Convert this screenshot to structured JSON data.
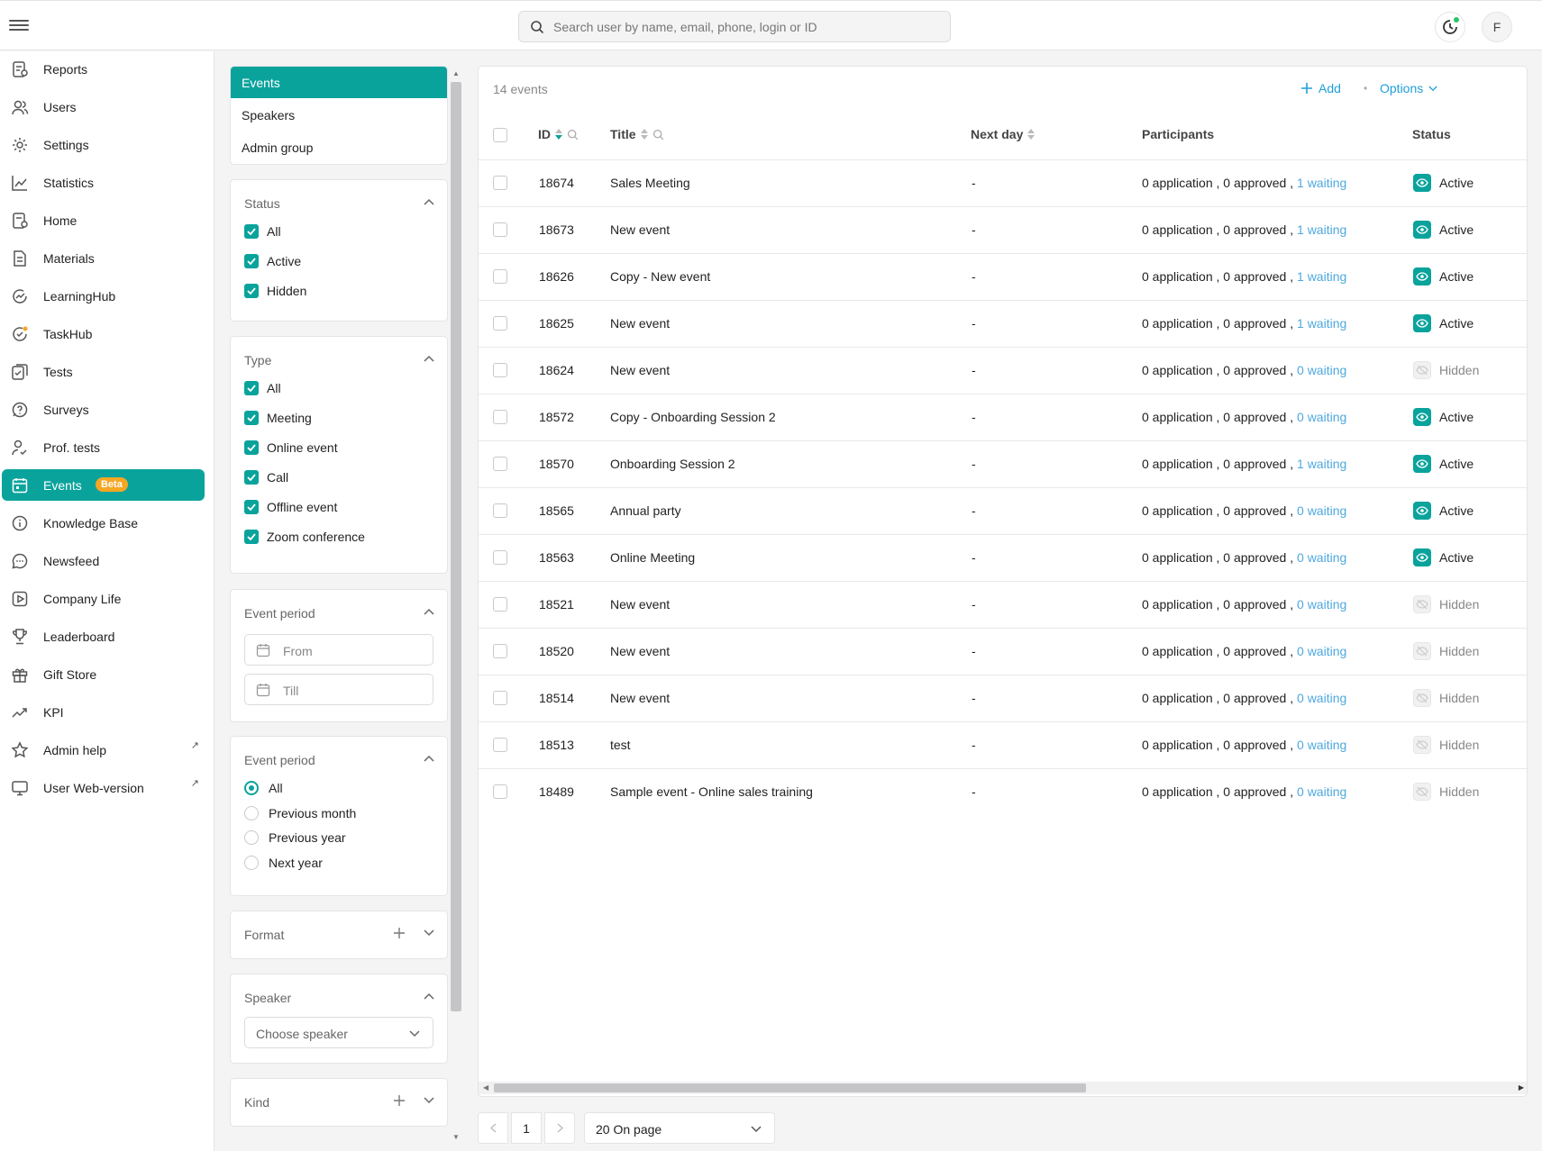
{
  "header": {
    "search_placeholder": "Search user by name, email, phone, login or ID",
    "avatar_initial": "F"
  },
  "sidebar": {
    "items": [
      {
        "label": "Reports",
        "icon": "report-icon"
      },
      {
        "label": "Users",
        "icon": "users-icon"
      },
      {
        "label": "Settings",
        "icon": "gear-icon"
      },
      {
        "label": "Statistics",
        "icon": "chart-icon"
      },
      {
        "label": "Home",
        "icon": "home-icon"
      },
      {
        "label": "Materials",
        "icon": "document-icon"
      },
      {
        "label": "LearningHub",
        "icon": "learning-icon"
      },
      {
        "label": "TaskHub",
        "icon": "task-icon"
      },
      {
        "label": "Tests",
        "icon": "test-icon"
      },
      {
        "label": "Surveys",
        "icon": "survey-icon"
      },
      {
        "label": "Prof. tests",
        "icon": "prof-test-icon"
      },
      {
        "label": "Events",
        "icon": "calendar-icon",
        "badge": "Beta",
        "active": true
      },
      {
        "label": "Knowledge Base",
        "icon": "info-icon"
      },
      {
        "label": "Newsfeed",
        "icon": "chat-icon"
      },
      {
        "label": "Company Life",
        "icon": "play-icon"
      },
      {
        "label": "Leaderboard",
        "icon": "trophy-icon"
      },
      {
        "label": "Gift Store",
        "icon": "gift-icon"
      },
      {
        "label": "KPI",
        "icon": "trend-icon"
      },
      {
        "label": "Admin help",
        "icon": "star-icon",
        "external": true
      },
      {
        "label": "User Web-version",
        "icon": "monitor-icon",
        "external": true
      }
    ]
  },
  "filters": {
    "categories": [
      "Events",
      "Speakers",
      "Admin group"
    ],
    "status": {
      "title": "Status",
      "options": [
        "All",
        "Active",
        "Hidden"
      ]
    },
    "type": {
      "title": "Type",
      "options": [
        "All",
        "Meeting",
        "Online event",
        "Call",
        "Offline event",
        "Zoom conference"
      ]
    },
    "event_period_dates": {
      "title": "Event period",
      "from_placeholder": "From",
      "till_placeholder": "Till"
    },
    "event_period_radio": {
      "title": "Event period",
      "options": [
        "All",
        "Previous month",
        "Previous year",
        "Next year"
      ],
      "selected": "All"
    },
    "format": {
      "title": "Format"
    },
    "speaker": {
      "title": "Speaker",
      "placeholder": "Choose speaker"
    },
    "kind": {
      "title": "Kind"
    }
  },
  "table": {
    "count_label": "14 events",
    "add_label": "Add",
    "options_label": "Options",
    "columns": [
      "ID",
      "Title",
      "Next day",
      "Participants",
      "Status"
    ],
    "rows": [
      {
        "id": "18674",
        "title": "Sales Meeting",
        "next_day": "-",
        "participants": "0 application , 0 approved ,",
        "waiting": "1 waiting",
        "status": "Active"
      },
      {
        "id": "18673",
        "title": "New event",
        "next_day": "-",
        "participants": "0 application , 0 approved ,",
        "waiting": "1 waiting",
        "status": "Active"
      },
      {
        "id": "18626",
        "title": "Copy - New event",
        "next_day": "-",
        "participants": "0 application , 0 approved ,",
        "waiting": "1 waiting",
        "status": "Active"
      },
      {
        "id": "18625",
        "title": "New event",
        "next_day": "-",
        "participants": "0 application , 0 approved ,",
        "waiting": "1 waiting",
        "status": "Active"
      },
      {
        "id": "18624",
        "title": "New event",
        "next_day": "-",
        "participants": "0 application , 0 approved ,",
        "waiting": "0 waiting",
        "status": "Hidden"
      },
      {
        "id": "18572",
        "title": "Copy - Onboarding Session 2",
        "next_day": "-",
        "participants": "0 application , 0 approved ,",
        "waiting": "0 waiting",
        "status": "Active"
      },
      {
        "id": "18570",
        "title": "Onboarding Session 2",
        "next_day": "-",
        "participants": "0 application , 0 approved ,",
        "waiting": "1 waiting",
        "status": "Active"
      },
      {
        "id": "18565",
        "title": "Annual party",
        "next_day": "-",
        "participants": "0 application , 0 approved ,",
        "waiting": "0 waiting",
        "status": "Active"
      },
      {
        "id": "18563",
        "title": "Online Meeting",
        "next_day": "-",
        "participants": "0 application , 0 approved ,",
        "waiting": "0 waiting",
        "status": "Active"
      },
      {
        "id": "18521",
        "title": "New event",
        "next_day": "-",
        "participants": "0 application , 0 approved ,",
        "waiting": "0 waiting",
        "status": "Hidden"
      },
      {
        "id": "18520",
        "title": "New event",
        "next_day": "-",
        "participants": "0 application , 0 approved ,",
        "waiting": "0 waiting",
        "status": "Hidden"
      },
      {
        "id": "18514",
        "title": "New event",
        "next_day": "-",
        "participants": "0 application , 0 approved ,",
        "waiting": "0 waiting",
        "status": "Hidden"
      },
      {
        "id": "18513",
        "title": "test",
        "next_day": "-",
        "participants": "0 application , 0 approved ,",
        "waiting": "0 waiting",
        "status": "Hidden"
      },
      {
        "id": "18489",
        "title": "Sample event - Online sales training",
        "next_day": "-",
        "participants": "0 application , 0 approved ,",
        "waiting": "0 waiting",
        "status": "Hidden"
      }
    ]
  },
  "pagination": {
    "current_page": "1",
    "per_page": "20 On page"
  },
  "colors": {
    "accent": "#0aa39c",
    "link": "#1f9fd8",
    "waiting": "#4fa8de",
    "badge": "#f5a623"
  }
}
